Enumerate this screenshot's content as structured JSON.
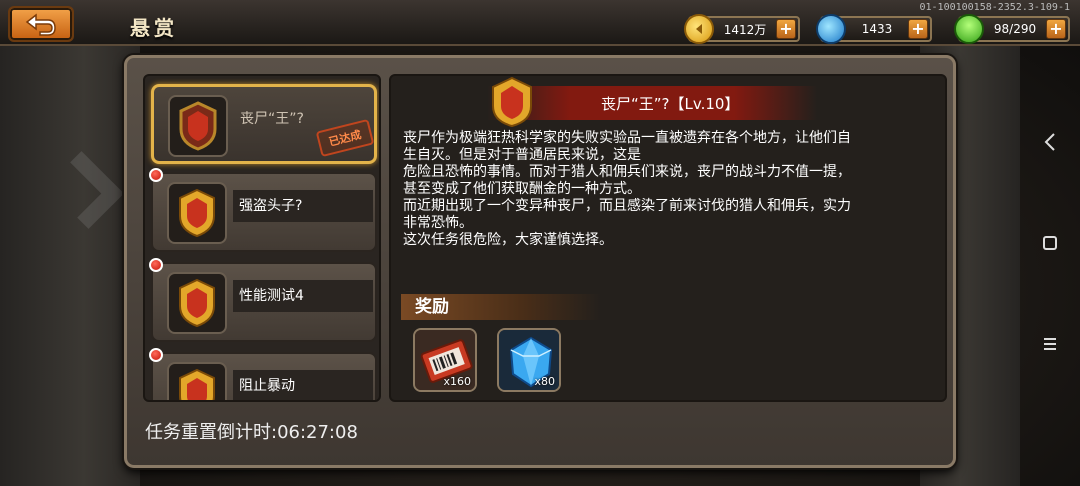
{
  "header": {
    "title": "悬赏",
    "version": "01-100100158-2352.3-109-1"
  },
  "resources": {
    "gold": "1412万",
    "gems": "1433",
    "stamina": "98/290"
  },
  "quests": [
    {
      "name": "丧尸“王”?",
      "completed": true,
      "stamp": "已达成",
      "new": false
    },
    {
      "name": "强盗头子?",
      "completed": false,
      "new": true
    },
    {
      "name": "性能测试4",
      "completed": false,
      "new": true
    },
    {
      "name": "阻止暴动",
      "completed": false,
      "new": true
    }
  ],
  "detail": {
    "title": "丧尸“王”?【Lv.10】",
    "description": [
      "丧尸作为极端狂热科学家的失败实验品一直被遗弃在各个地方，让他们自",
      "生自灭。但是对于普通居民来说，这是",
      "危险且恐怖的事情。而对于猎人和佣兵们来说，丧尸的战斗力不值一提，",
      "甚至变成了他们获取酬金的一种方式。",
      "而近期出现了一个变异种丧尸，而且感染了前来讨伐的猎人和佣兵，实力",
      "非常恐怖。",
      "这次任务很危险，大家谨慎选择。"
    ],
    "reward_label": "奖励",
    "rewards": [
      {
        "icon": "ticket-icon",
        "qty": "x160"
      },
      {
        "icon": "blue-gem-icon",
        "qty": "x80"
      }
    ]
  },
  "countdown": "任务重置倒计时:06:27:08",
  "colors": {
    "accent_gold": "#e3b34a",
    "header_red": "#8c190f",
    "button_orange": "#f3a34a"
  }
}
